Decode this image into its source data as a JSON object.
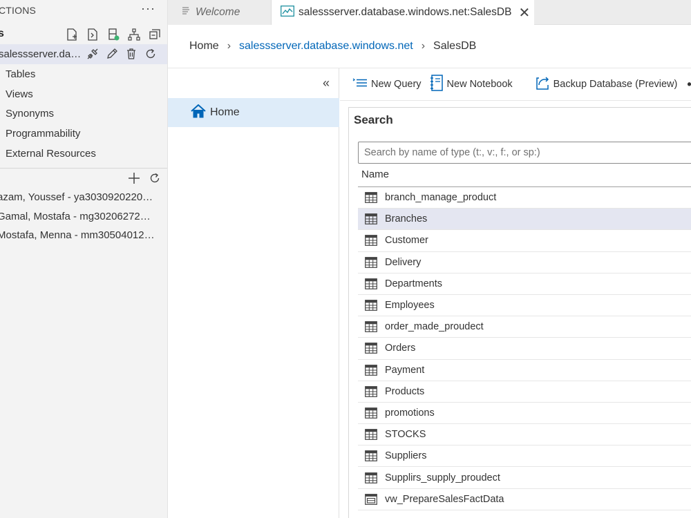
{
  "sidebar": {
    "header_title": "CTIONS",
    "more_label": "···",
    "section_title": "s",
    "server": {
      "label": "salessserver.data..."
    },
    "tree_items": [
      "Tables",
      "Views",
      "Synonyms",
      "Programmability",
      "External Resources"
    ],
    "connections": [
      "azam, Youssef - ya303092022003...",
      "Gamal, Mostafa - mg3020627220...",
      "Mostafa, Menna - mm305040122..."
    ]
  },
  "tabs": [
    {
      "label": "Welcome"
    },
    {
      "label": "salessserver.database.windows.net:SalesDB",
      "close": "✕"
    }
  ],
  "breadcrumb": {
    "home": "Home",
    "server": "salessserver.database.windows.net",
    "database": "SalesDB",
    "separator": "›"
  },
  "dashboard_nav": {
    "collapse": "«",
    "home_label": "Home"
  },
  "toolbar": {
    "new_query": "New Query",
    "new_notebook": "New Notebook",
    "backup": "Backup Database (Preview)",
    "more": "•••"
  },
  "search": {
    "title": "Search",
    "placeholder": "Search by name of type (t:, v:, f:, or sp:)",
    "column_name": "Name",
    "rows": [
      {
        "name": "branch_manage_product",
        "icon": "table-icon"
      },
      {
        "name": "Branches",
        "icon": "table-icon",
        "selected": true
      },
      {
        "name": "Customer",
        "icon": "table-icon"
      },
      {
        "name": "Delivery",
        "icon": "table-icon"
      },
      {
        "name": "Departments",
        "icon": "table-icon"
      },
      {
        "name": "Employees",
        "icon": "table-icon"
      },
      {
        "name": "order_made_proudect",
        "icon": "table-icon"
      },
      {
        "name": "Orders",
        "icon": "table-icon"
      },
      {
        "name": "Payment",
        "icon": "table-icon"
      },
      {
        "name": "Products",
        "icon": "table-icon"
      },
      {
        "name": "promotions",
        "icon": "table-icon"
      },
      {
        "name": "STOCKS",
        "icon": "table-icon"
      },
      {
        "name": "Suppliers",
        "icon": "table-icon"
      },
      {
        "name": "Supplirs_supply_proudect",
        "icon": "table-icon"
      },
      {
        "name": "vw_PrepareSalesFactData",
        "icon": "view-icon"
      }
    ]
  },
  "colors": {
    "accent": "#0066b8",
    "selection": "#e4e6f1",
    "home_highlight": "#deecf9",
    "status_green": "#3cb371"
  }
}
